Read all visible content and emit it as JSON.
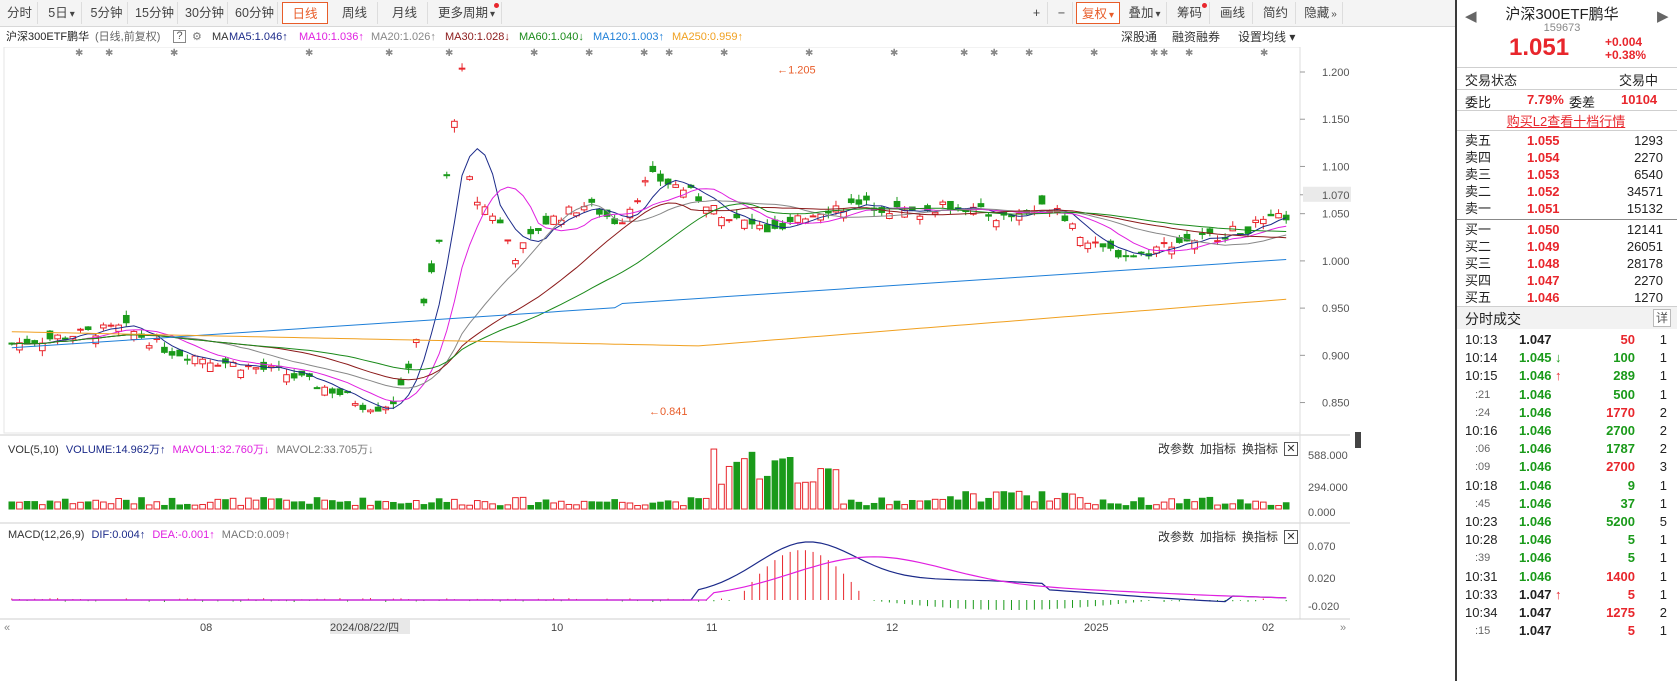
{
  "toolbar": {
    "tabs": [
      {
        "label": "分时"
      },
      {
        "label": "5日",
        "caret": "▾"
      },
      {
        "label": "5分钟"
      },
      {
        "label": "15分钟"
      },
      {
        "label": "30分钟"
      },
      {
        "label": "60分钟"
      },
      {
        "label": "日线",
        "active": true
      },
      {
        "label": "周线"
      },
      {
        "label": "月线"
      },
      {
        "label": "更多周期",
        "caret": "▾",
        "dot": true
      }
    ],
    "right": [
      {
        "label": "+"
      },
      {
        "label": "−"
      },
      {
        "label": "复权",
        "caret": "▾",
        "active": true
      },
      {
        "label": "叠加",
        "caret": "▾"
      },
      {
        "label": "筹码",
        "dot": true
      },
      {
        "label": "画线"
      },
      {
        "label": "简约"
      },
      {
        "label": "隐藏",
        "caret": "»"
      }
    ]
  },
  "legend": {
    "name": "沪深300ETF鹏华",
    "mode": "(日线,前复权)",
    "help": "?",
    "ma_label": "MA",
    "items": [
      {
        "text": "MA5:1.046",
        "arrow": "↑",
        "color": "#1c2b8a"
      },
      {
        "text": "MA10:1.036",
        "arrow": "↑",
        "color": "#e020e0"
      },
      {
        "text": "MA20:1.026",
        "arrow": "↑",
        "color": "#888888"
      },
      {
        "text": "MA30:1.028",
        "arrow": "↓",
        "color": "#8b1a1a"
      },
      {
        "text": "MA60:1.040",
        "arrow": "↓",
        "color": "#1a8a1a"
      },
      {
        "text": "MA120:1.003",
        "arrow": "↑",
        "color": "#1e7fd8"
      },
      {
        "text": "MA250:0.959",
        "arrow": "↑",
        "color": "#f0a020"
      }
    ],
    "links": [
      "深股通",
      "融资融券",
      "设置均线 ▾"
    ]
  },
  "price_axis": [
    "1.200",
    "1.150",
    "1.100",
    "1.070",
    "1.050",
    "1.000",
    "0.950",
    "0.900",
    "0.850"
  ],
  "annotations": {
    "high": "1.205",
    "low": "0.841"
  },
  "vol_pane": {
    "label": "VOL(5,10)",
    "volume": "VOLUME:14.962万",
    "mavol1": "MAVOL1:32.760万",
    "mavol2": "MAVOL2:33.705万",
    "axis": [
      "588.000",
      "294.000",
      "0.000"
    ],
    "buttons": [
      "改参数",
      "加指标",
      "换指标"
    ]
  },
  "macd_pane": {
    "label": "MACD(12,26,9)",
    "dif": "DIF:0.004",
    "dea": "DEA:-0.001",
    "macd": "MACD:0.009",
    "axis": [
      "0.070",
      "0.020",
      "-0.020"
    ],
    "buttons": [
      "改参数",
      "加指标",
      "换指标"
    ]
  },
  "time_axis": [
    "08",
    "2024/08/22/四",
    "10",
    "11",
    "12",
    "2025",
    "02"
  ],
  "panel": {
    "title": "沪深300ETF鹏华",
    "code": "159673",
    "price": "1.051",
    "change": "+0.004",
    "pct": "+0.38%",
    "status_label": "交易状态",
    "status_value": "交易中",
    "ratio_label": "委比",
    "ratio_value": "7.79%",
    "diff_label": "委差",
    "diff_value": "10104",
    "l2_link": "购买L2查看十档行情",
    "asks": [
      {
        "label": "卖五",
        "price": "1.055",
        "vol": "1293"
      },
      {
        "label": "卖四",
        "price": "1.054",
        "vol": "2270"
      },
      {
        "label": "卖三",
        "price": "1.053",
        "vol": "6540"
      },
      {
        "label": "卖二",
        "price": "1.052",
        "vol": "34571"
      },
      {
        "label": "卖一",
        "price": "1.051",
        "vol": "15132"
      }
    ],
    "bids": [
      {
        "label": "买一",
        "price": "1.050",
        "vol": "12141"
      },
      {
        "label": "买二",
        "price": "1.049",
        "vol": "26051"
      },
      {
        "label": "买三",
        "price": "1.048",
        "vol": "28178"
      },
      {
        "label": "买四",
        "price": "1.047",
        "vol": "2270"
      },
      {
        "label": "买五",
        "price": "1.046",
        "vol": "1270"
      }
    ],
    "trades_title": "分时成交",
    "trades_btn": "详",
    "trades": [
      {
        "t": "10:13",
        "p": "1.047",
        "pc": "blk",
        "v": "50",
        "vc": "red",
        "n": "1"
      },
      {
        "t": "10:14",
        "p": "1.045",
        "pc": "green",
        "arrow": "↓",
        "v": "100",
        "vc": "green",
        "n": "1"
      },
      {
        "t": "10:15",
        "p": "1.046",
        "pc": "green",
        "arrow": "↑",
        "v": "289",
        "vc": "green",
        "n": "1"
      },
      {
        "t": ":21",
        "p": "1.046",
        "pc": "green",
        "v": "500",
        "vc": "green",
        "n": "1"
      },
      {
        "t": ":24",
        "p": "1.046",
        "pc": "green",
        "v": "1770",
        "vc": "red",
        "n": "2"
      },
      {
        "t": "10:16",
        "p": "1.046",
        "pc": "green",
        "v": "2700",
        "vc": "green",
        "n": "2"
      },
      {
        "t": ":06",
        "p": "1.046",
        "pc": "green",
        "v": "1787",
        "vc": "green",
        "n": "2"
      },
      {
        "t": ":09",
        "p": "1.046",
        "pc": "green",
        "v": "2700",
        "vc": "red",
        "n": "3"
      },
      {
        "t": "10:18",
        "p": "1.046",
        "pc": "green",
        "v": "9",
        "vc": "green",
        "n": "1"
      },
      {
        "t": ":45",
        "p": "1.046",
        "pc": "green",
        "v": "37",
        "vc": "green",
        "n": "1"
      },
      {
        "t": "10:23",
        "p": "1.046",
        "pc": "green",
        "v": "5200",
        "vc": "green",
        "n": "5"
      },
      {
        "t": "10:28",
        "p": "1.046",
        "pc": "green",
        "v": "5",
        "vc": "green",
        "n": "1"
      },
      {
        "t": ":39",
        "p": "1.046",
        "pc": "green",
        "v": "5",
        "vc": "green",
        "n": "1"
      },
      {
        "t": "10:31",
        "p": "1.046",
        "pc": "green",
        "v": "1400",
        "vc": "red",
        "n": "1"
      },
      {
        "t": "10:33",
        "p": "1.047",
        "pc": "blk",
        "arrow": "↑",
        "v": "5",
        "vc": "red",
        "n": "1"
      },
      {
        "t": "10:34",
        "p": "1.047",
        "pc": "blk",
        "v": "1275",
        "vc": "red",
        "n": "2"
      },
      {
        "t": ":15",
        "p": "1.047",
        "pc": "blk",
        "v": "5",
        "vc": "red",
        "n": "1"
      }
    ]
  },
  "colors": {
    "up": "#e8262c",
    "down": "#1a9a1a",
    "accent": "#e85d2a"
  }
}
